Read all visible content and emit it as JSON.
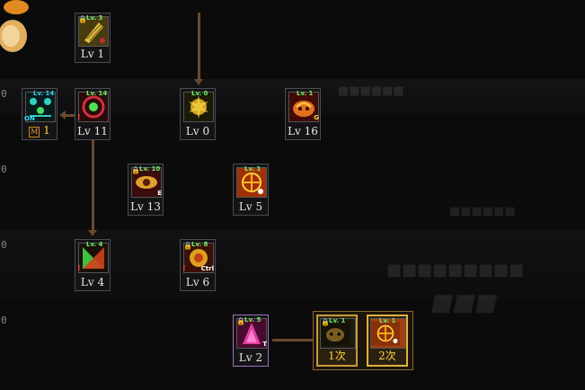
{
  "rows": [
    "0",
    "0",
    "0",
    "0"
  ],
  "skills": [
    {
      "id": "s1",
      "label": "Lv 1",
      "tag": "Lv. 3",
      "corner": "⊕"
    },
    {
      "id": "s2",
      "label": "1",
      "tag": "Lv. 14",
      "corner": "ON"
    },
    {
      "id": "s3",
      "label": "Lv 11",
      "tag": "Lv. 14",
      "corner": ""
    },
    {
      "id": "s4",
      "label": "Lv 0",
      "tag": "Lv. 0",
      "corner": ""
    },
    {
      "id": "s5",
      "label": "Lv 16",
      "tag": "Lv. 1",
      "corner": "G"
    },
    {
      "id": "s6",
      "label": "Lv 13",
      "tag": "Lv. 10",
      "corner": "E"
    },
    {
      "id": "s7",
      "label": "Lv 5",
      "tag": "Lv. 1",
      "corner": ""
    },
    {
      "id": "s8",
      "label": "Lv 4",
      "tag": "Lv. 4",
      "corner": ""
    },
    {
      "id": "s9",
      "label": "Lv 6",
      "tag": "Lv. 8",
      "corner": "Ctrl"
    },
    {
      "id": "s10",
      "label": "Lv 2",
      "tag": "Lv. 5",
      "corner": "T"
    },
    {
      "id": "s11",
      "label": "1次",
      "tag": "Lv. 1",
      "corner": ""
    },
    {
      "id": "s12",
      "label": "2次",
      "tag": "Lv. 1",
      "corner": ""
    }
  ],
  "colors": {
    "connector": "#6a4a2e",
    "level_text": "#e8e8e8",
    "gold_text": "#ffd24a",
    "lock_tag": "#6cf06c"
  },
  "icons": [
    "skill-icon",
    "lock-icon",
    "warning-icon",
    "arrow-down-icon",
    "arrow-left-icon"
  ]
}
